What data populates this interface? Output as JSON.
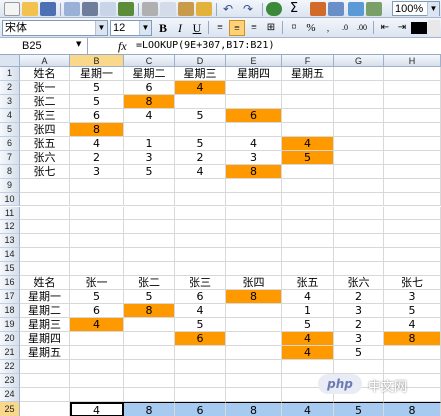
{
  "toolbar": {
    "font_name": "宋体",
    "font_size": "12",
    "bold": "B",
    "italic": "I",
    "underline": "U",
    "zoom": "100%",
    "sigma": "Σ",
    "percent": "%"
  },
  "formula_bar": {
    "name_box": "B25",
    "fx": "fx",
    "formula": "=LOOKUP(9E+307,B17:B21)"
  },
  "columns": [
    "A",
    "B",
    "C",
    "D",
    "E",
    "F",
    "G",
    "H"
  ],
  "rows": [
    "1",
    "2",
    "3",
    "4",
    "5",
    "6",
    "7",
    "8",
    "9",
    "10",
    "11",
    "12",
    "13",
    "14",
    "15",
    "16",
    "17",
    "18",
    "19",
    "20",
    "21",
    "22",
    "23",
    "24",
    "25"
  ],
  "table1": {
    "header": [
      "姓名",
      "星期一",
      "星期二",
      "星期三",
      "星期四",
      "星期五"
    ],
    "rows": [
      [
        "张一",
        "5",
        "6",
        "4",
        "",
        ""
      ],
      [
        "张二",
        "5",
        "8",
        "",
        "",
        ""
      ],
      [
        "张三",
        "6",
        "4",
        "5",
        "6",
        ""
      ],
      [
        "张四",
        "8",
        "",
        "",
        "",
        ""
      ],
      [
        "张五",
        "4",
        "1",
        "5",
        "4",
        "4"
      ],
      [
        "张六",
        "2",
        "3",
        "2",
        "3",
        "5"
      ],
      [
        "张七",
        "3",
        "5",
        "4",
        "8",
        ""
      ]
    ],
    "highlight_color": "#ff9900"
  },
  "table2": {
    "header": [
      "姓名",
      "张一",
      "张二",
      "张三",
      "张四",
      "张五",
      "张六",
      "张七"
    ],
    "rows": [
      [
        "星期一",
        "5",
        "5",
        "6",
        "8",
        "4",
        "2",
        "3"
      ],
      [
        "星期二",
        "6",
        "8",
        "4",
        "",
        "1",
        "3",
        "5"
      ],
      [
        "星期三",
        "4",
        "",
        "5",
        "",
        "5",
        "2",
        "4"
      ],
      [
        "星期四",
        "",
        "",
        "6",
        "",
        "4",
        "3",
        "8"
      ],
      [
        "星期五",
        "",
        "",
        "",
        "",
        "4",
        "5",
        ""
      ]
    ]
  },
  "result_row": [
    "4",
    "8",
    "6",
    "8",
    "4",
    "5",
    "8"
  ],
  "selection_color": "#a6caf0",
  "watermark": {
    "logo": "php",
    "text": "中文网"
  }
}
